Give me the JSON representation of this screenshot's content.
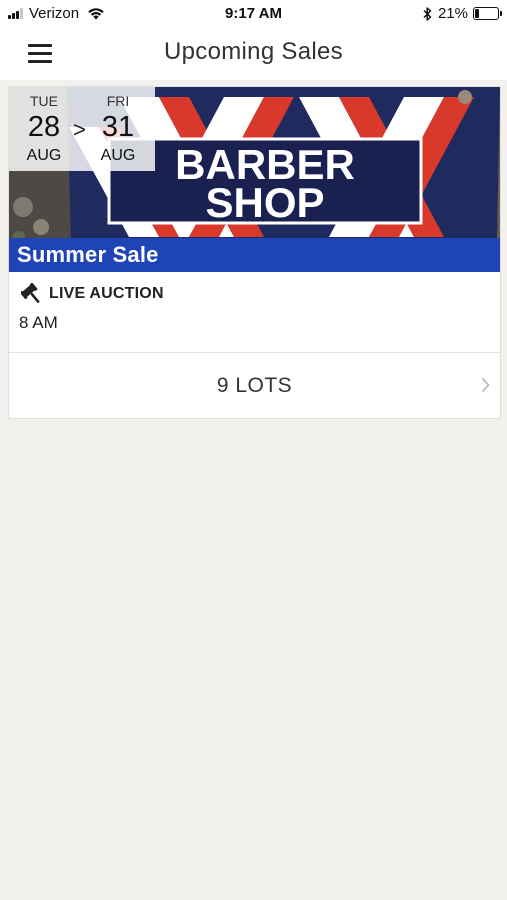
{
  "status_bar": {
    "carrier": "Verizon",
    "time": "9:17 AM",
    "battery": "21%",
    "battery_fraction": 0.21,
    "signal_bars": 3,
    "icons": [
      "signal-icon",
      "wifi-icon",
      "bluetooth-icon",
      "battery-icon"
    ]
  },
  "header": {
    "title": "Upcoming Sales",
    "menu_icon": "menu-icon"
  },
  "sale": {
    "start": {
      "weekday": "TUE",
      "day": "28",
      "month": "AUG"
    },
    "end": {
      "weekday": "FRI",
      "day": "31",
      "month": "AUG"
    },
    "date_separator": ">",
    "image_sign_text": [
      "BARBER",
      "SHOP"
    ],
    "title": "Summer Sale",
    "auction_type": "LIVE AUCTION",
    "auction_icon": "gavel-icon",
    "time": "8 AM",
    "lots_label": "9 LOTS",
    "accent_color": "#1f44b8"
  }
}
